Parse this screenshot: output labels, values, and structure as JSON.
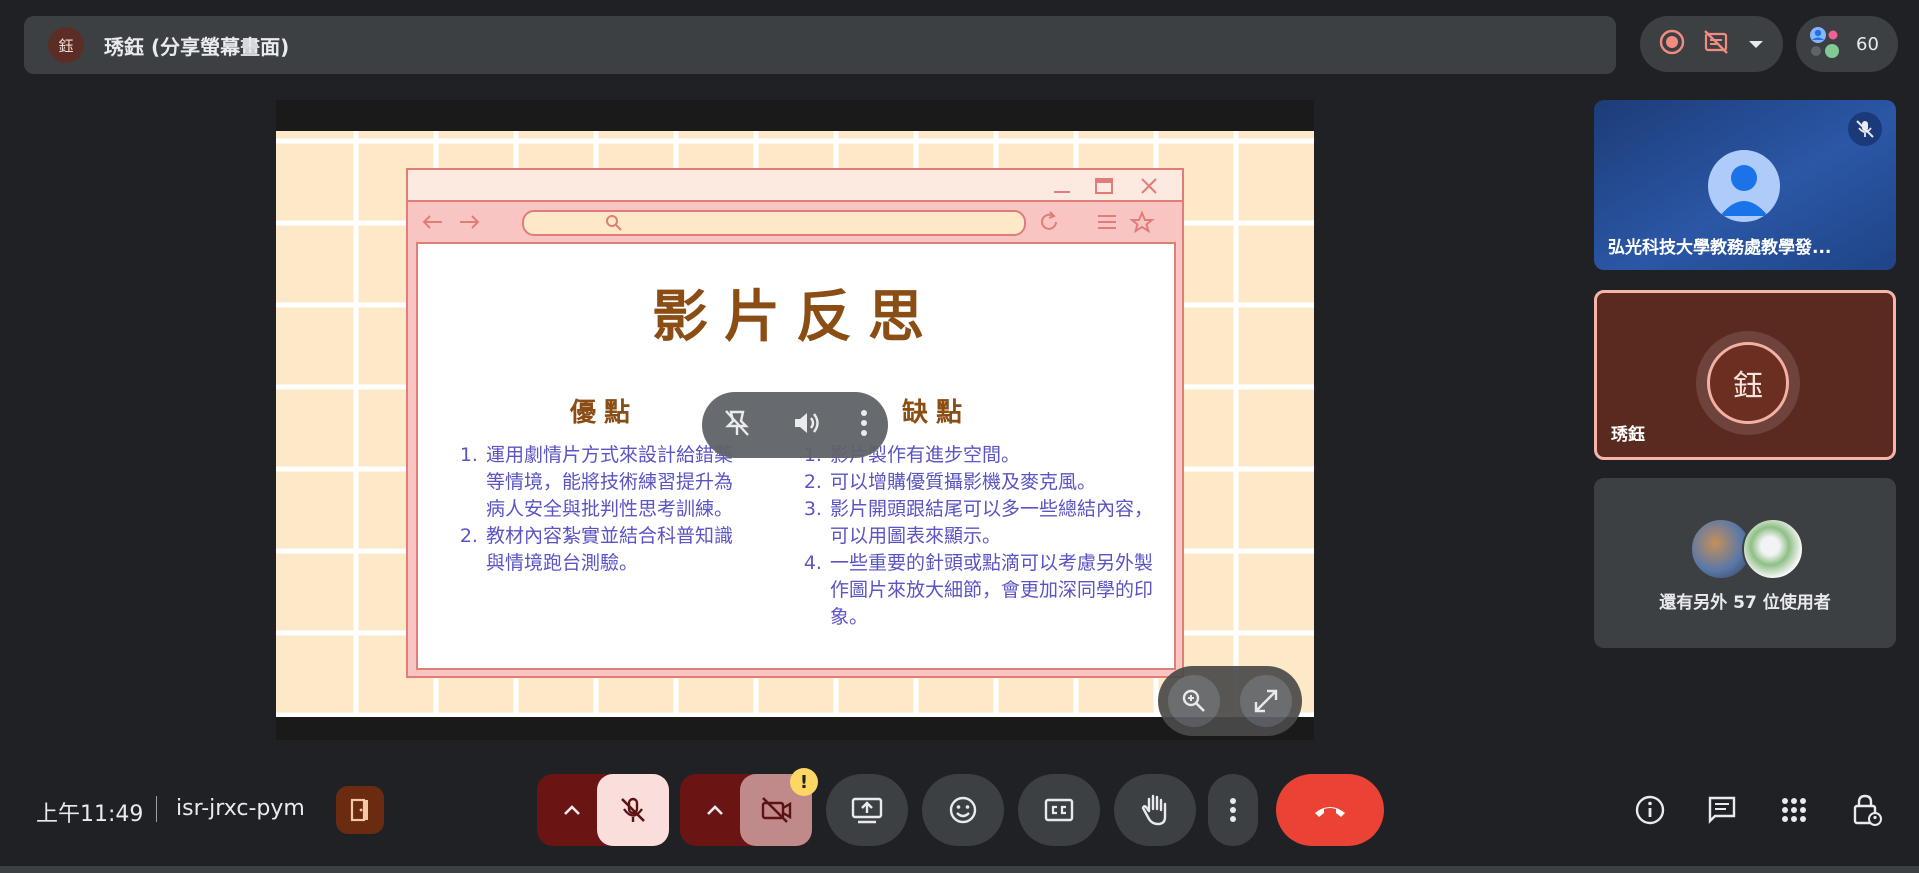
{
  "presenter": {
    "avatar_letter": "鈺",
    "title": "琇鈺 (分享螢幕畫面)"
  },
  "participants": {
    "count": "60"
  },
  "slide": {
    "heading": "影片反思",
    "pros_title": "優點",
    "pros": [
      "運用劇情片方式來設計給錯藥等情境，能將技術練習提升為病人安全與批判性思考訓練。",
      "教材內容紮實並結合科普知識與情境跑台測驗。"
    ],
    "cons_title": "缺點",
    "cons": [
      "影片製作有進步空間。",
      "可以增購優質攝影機及麥克風。",
      "影片開頭跟結尾可以多一些總結內容，可以用圖表來顯示。",
      "一些重要的針頭或點滴可以考慮另外製作圖片來放大細節，會更加深同學的印象。"
    ]
  },
  "tiles": [
    {
      "name": "弘光科技大學教務處教學發..."
    },
    {
      "name": "琇鈺",
      "avatar_letter": "鈺"
    },
    {
      "others_text": "還有另外 57 位使用者"
    }
  ],
  "bottom": {
    "time": "上午11:49",
    "meeting_code": "isr-jrxc-pym",
    "cam_warning": "!"
  },
  "colors": {
    "background": "#202124",
    "leave": "#ea4335",
    "muted_red": "#6a1414",
    "slide_bg": "#fde9c7",
    "slide_text": "#5b54c4",
    "slide_heading": "#8a4d14"
  }
}
